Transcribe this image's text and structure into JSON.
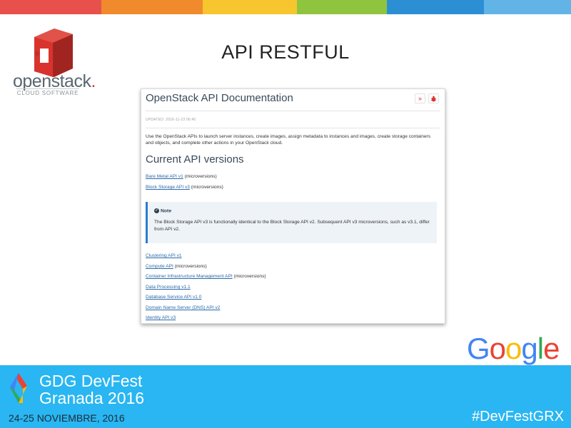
{
  "stripe_colors": [
    "#e8514b",
    "#f08a2c",
    "#f7c62e",
    "#8fc43f",
    "#2d8fd3",
    "#63b4e6"
  ],
  "logo": {
    "word": "openstack",
    "dot": ".",
    "subtitle": "CLOUD SOFTWARE"
  },
  "slide": {
    "title": "API RESTFUL"
  },
  "doc": {
    "title": "OpenStack API Documentation",
    "icons": [
      "»",
      "bug-icon"
    ],
    "updated": "UPDATED: 2016-11-23 06:45",
    "intro": "Use the OpenStack APIs to launch server instances, create images, assign metadata to instances and images, create storage containers and objects, and complete other actions in your OpenStack cloud.",
    "section_title": "Current API versions",
    "links_top": [
      {
        "link": "Bare Metal API v1",
        "suffix": " (microversions)"
      },
      {
        "link": "Block Storage API v3",
        "suffix": " (microversions)"
      }
    ],
    "note": {
      "heading": "Note",
      "text": "The Block Storage API v3 is functionally identical to the Block Storage API v2. Subsequent API v3 microversions, such as v3.1, differ from API v2."
    },
    "links_bottom": [
      {
        "link": "Clustering API v1",
        "suffix": ""
      },
      {
        "link": "Compute API",
        "suffix": " (microversions)"
      },
      {
        "link": "Container Infrastructure Management API",
        "suffix": " (microversions)"
      },
      {
        "link": "Data Processing v1.1",
        "suffix": ""
      },
      {
        "link": "Database Service API v1.0",
        "suffix": ""
      },
      {
        "link": "Domain Name Server (DNS) API v2",
        "suffix": ""
      },
      {
        "link": "Identity API v3",
        "suffix": ""
      }
    ]
  },
  "google": {
    "letters": [
      "G",
      "o",
      "o",
      "g",
      "l",
      "e"
    ],
    "colors": [
      "#4285f4",
      "#ea4335",
      "#fbbc05",
      "#4285f4",
      "#34a853",
      "#ea4335"
    ]
  },
  "footer": {
    "event_line1": "GDG DevFest",
    "event_line2": "Granada 2016",
    "date": "24-25 NOVIEMBRE, 2016",
    "hashtag": "#DevFestGRX"
  }
}
